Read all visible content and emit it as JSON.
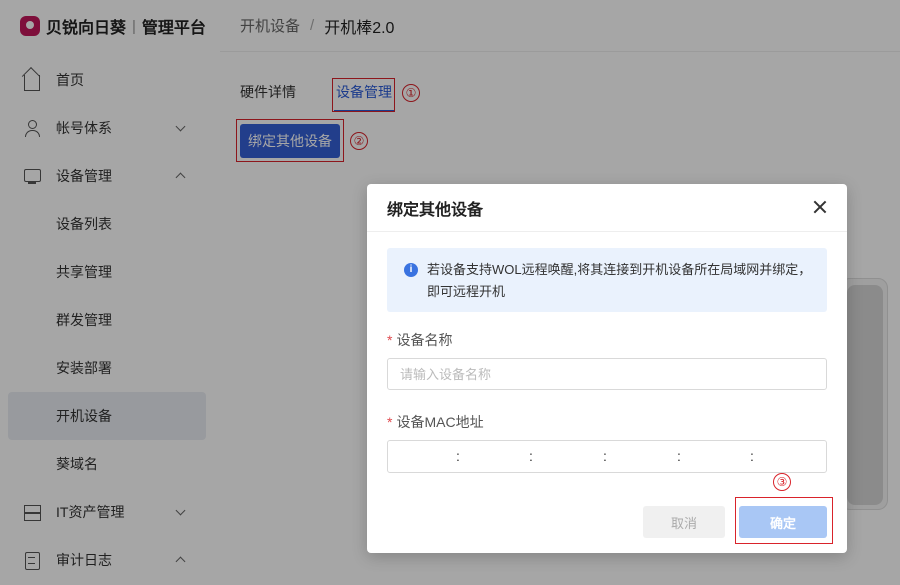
{
  "app": {
    "brand": "贝锐向日葵",
    "separator": "|",
    "subtitle": "管理平台"
  },
  "sidebar": {
    "items": [
      {
        "label": "首页",
        "icon": "home-icon"
      },
      {
        "label": "帐号体系",
        "icon": "user-icon",
        "chevron": "down"
      },
      {
        "label": "设备管理",
        "icon": "monitor-icon",
        "chevron": "up"
      },
      {
        "label": "设备列表"
      },
      {
        "label": "共享管理"
      },
      {
        "label": "群发管理"
      },
      {
        "label": "安装部署"
      },
      {
        "label": "开机设备",
        "active": true
      },
      {
        "label": "葵域名"
      },
      {
        "label": "IT资产管理",
        "icon": "server-icon",
        "chevron": "down"
      },
      {
        "label": "审计日志",
        "icon": "doc-icon",
        "chevron": "up"
      }
    ]
  },
  "breadcrumb": {
    "parent": "开机设备",
    "separator": "/",
    "current": "开机棒2.0"
  },
  "tabs": [
    {
      "label": "硬件详情"
    },
    {
      "label": "设备管理",
      "active": true
    }
  ],
  "annotations": {
    "one": "①",
    "two": "②",
    "three": "③"
  },
  "bind_button": {
    "label": "绑定其他设备"
  },
  "modal": {
    "title": "绑定其他设备",
    "info_text": "若设备支持WOL远程唤醒,将其连接到开机设备所在局域网并绑定，即可远程开机",
    "info_icon": "i",
    "required_mark": "*",
    "name_label": "设备名称",
    "name_placeholder": "请输入设备名称",
    "mac_label": "设备MAC地址",
    "mac_sep": ":",
    "cancel_label": "取消",
    "ok_label": "确定"
  },
  "colors": {
    "primary": "#3560d6",
    "annotation": "#d9232b",
    "info_bg": "#eaf2fd"
  }
}
